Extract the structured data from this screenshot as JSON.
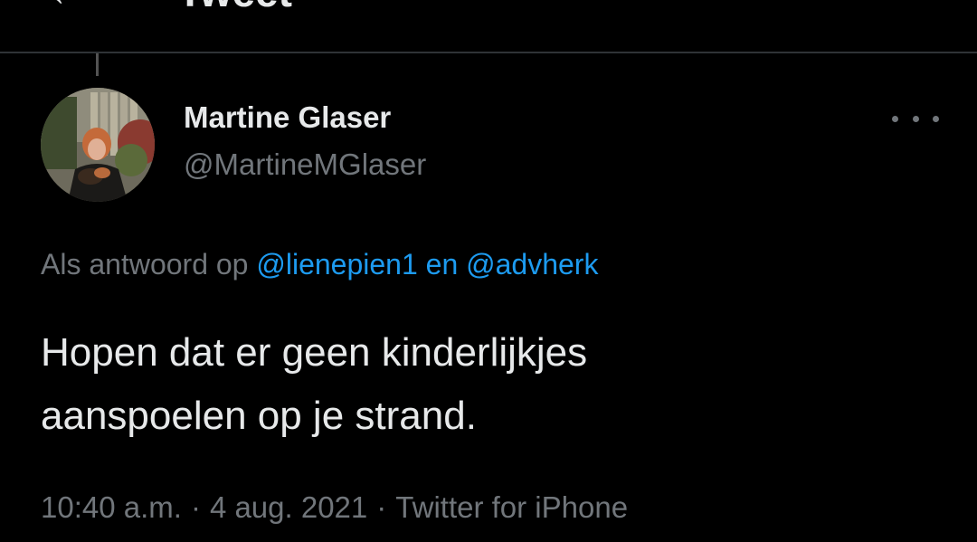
{
  "header": {
    "back_icon": "arrow-left-icon",
    "title": "Tweet"
  },
  "tweet": {
    "author": {
      "display_name": "Martine Glaser",
      "handle": "@MartineMGlaser",
      "avatar_icon": "profile-photo"
    },
    "more_icon": "more-horizontal-icon",
    "reply_to": {
      "prefix": "Als antwoord op",
      "mention_1": "@lienepien1",
      "conjunction": "en",
      "mention_2": "@advherk"
    },
    "text_line_1": "Hopen dat er geen kinderlijkjes",
    "text_line_2": "aanspoelen op je strand.",
    "time": "10:40 a.m.",
    "separator": "·",
    "date": "4 aug. 2021",
    "source": "Twitter for iPhone"
  },
  "colors": {
    "background": "#000000",
    "text_primary": "#e7e9ea",
    "text_secondary": "#71767b",
    "link": "#1d9bf0",
    "divider": "#2f3336"
  }
}
